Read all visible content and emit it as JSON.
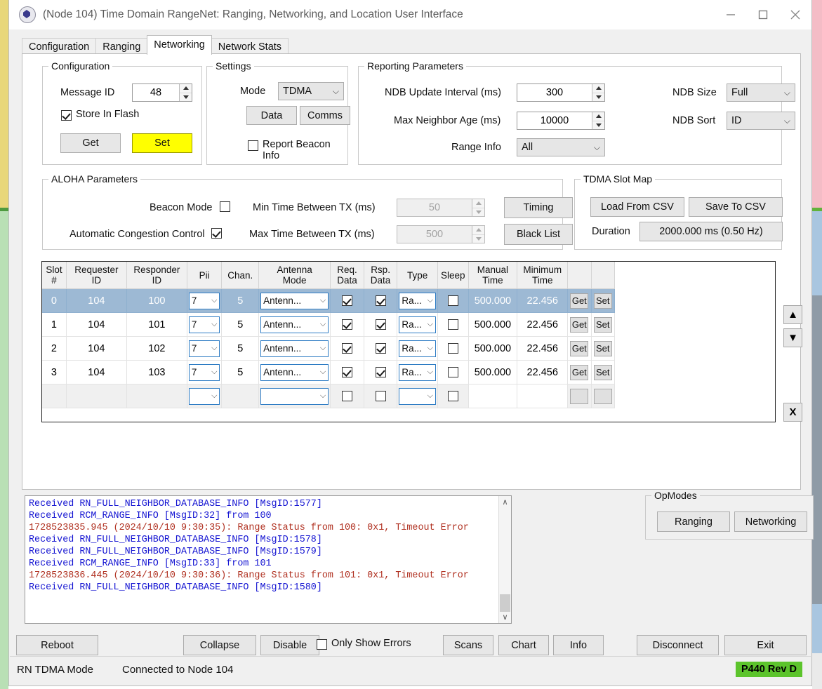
{
  "window": {
    "title": "(Node 104) Time Domain RangeNet: Ranging, Networking, and Location User Interface",
    "app_icon": "app-logo-icon",
    "minimize": "minimize-icon",
    "maximize": "maximize-icon",
    "close": "close-icon"
  },
  "tabs": [
    {
      "label": "Configuration",
      "active": false
    },
    {
      "label": "Ranging",
      "active": false
    },
    {
      "label": "Networking",
      "active": true
    },
    {
      "label": "Network Stats",
      "active": false
    }
  ],
  "configuration": {
    "legend": "Configuration",
    "message_id_label": "Message ID",
    "message_id_value": "48",
    "store_in_flash_label": "Store In Flash",
    "store_in_flash_checked": true,
    "get_label": "Get",
    "set_label": "Set",
    "set_highlight_color": "#ffff00"
  },
  "settings": {
    "legend": "Settings",
    "mode_label": "Mode",
    "mode_value": "TDMA",
    "data_label": "Data",
    "comms_label": "Comms",
    "report_beacon_label": "Report Beacon Info",
    "report_beacon_checked": false
  },
  "reporting": {
    "legend": "Reporting Parameters",
    "ndb_update_label": "NDB Update Interval (ms)",
    "ndb_update_value": "300",
    "max_neighbor_age_label": "Max Neighbor Age (ms)",
    "max_neighbor_age_value": "10000",
    "range_info_label": "Range Info",
    "range_info_value": "All",
    "ndb_size_label": "NDB Size",
    "ndb_size_value": "Full",
    "ndb_sort_label": "NDB Sort",
    "ndb_sort_value": "ID"
  },
  "aloha": {
    "legend": "ALOHA Parameters",
    "beacon_mode_label": "Beacon Mode",
    "beacon_mode_checked": false,
    "acc_label": "Automatic Congestion Control",
    "acc_checked": true,
    "min_tx_label": "Min Time Between TX (ms)",
    "min_tx_value": "50",
    "max_tx_label": "Max Time Between TX (ms)",
    "max_tx_value": "500",
    "timing_label": "Timing",
    "blacklist_label": "Black List"
  },
  "tdma_slot_map": {
    "legend": "TDMA Slot Map",
    "load_csv_label": "Load From CSV",
    "save_csv_label": "Save To CSV",
    "duration_label": "Duration",
    "duration_value": "2000.000 ms (0.50 Hz)"
  },
  "slot_table": {
    "headers": [
      "Slot\n#",
      "Requester\nID",
      "Responder\nID",
      "Pii",
      "Chan.",
      "Antenna\nMode",
      "Req.\nData",
      "Rsp.\nData",
      "Type",
      "Sleep",
      "Manual\nTime",
      "Minimum\nTime",
      "",
      ""
    ],
    "rows": [
      {
        "slot": "0",
        "requester": "104",
        "responder": "100",
        "pii": "7",
        "chan": "5",
        "antenna": "Antenn...",
        "req_data": true,
        "rsp_data": true,
        "type": "Ra...",
        "sleep": false,
        "manual": "500.000",
        "minimum": "22.456",
        "btn1": "Get",
        "btn2": "Set",
        "selected": true
      },
      {
        "slot": "1",
        "requester": "104",
        "responder": "101",
        "pii": "7",
        "chan": "5",
        "antenna": "Antenn...",
        "req_data": true,
        "rsp_data": true,
        "type": "Ra...",
        "sleep": false,
        "manual": "500.000",
        "minimum": "22.456",
        "btn1": "Get",
        "btn2": "Set",
        "selected": false
      },
      {
        "slot": "2",
        "requester": "104",
        "responder": "102",
        "pii": "7",
        "chan": "5",
        "antenna": "Antenn...",
        "req_data": true,
        "rsp_data": true,
        "type": "Ra...",
        "sleep": false,
        "manual": "500.000",
        "minimum": "22.456",
        "btn1": "Get",
        "btn2": "Set",
        "selected": false
      },
      {
        "slot": "3",
        "requester": "104",
        "responder": "103",
        "pii": "7",
        "chan": "5",
        "antenna": "Antenn...",
        "req_data": true,
        "rsp_data": true,
        "type": "Ra...",
        "sleep": false,
        "manual": "500.000",
        "minimum": "22.456",
        "btn1": "Get",
        "btn2": "Set",
        "selected": false
      },
      {
        "slot": "",
        "requester": "",
        "responder": "",
        "pii": "",
        "chan": "",
        "antenna": "",
        "req_data": false,
        "rsp_data": false,
        "type": "",
        "sleep": false,
        "manual": "",
        "minimum": "",
        "btn1": "",
        "btn2": "",
        "selected": false,
        "empty": true
      }
    ],
    "side_buttons": {
      "up": "▲",
      "down": "▼",
      "delete": "X"
    }
  },
  "log": {
    "lines": [
      {
        "text": "Received RN_FULL_NEIGHBOR_DATABASE_INFO [MsgID:1577]",
        "color": "blue"
      },
      {
        "text": "Received RCM_RANGE_INFO [MsgID:32] from 100",
        "color": "blue"
      },
      {
        "text": "1728523835.945 (2024/10/10 9:30:35): Range Status from 100: 0x1, Timeout Error",
        "color": "red"
      },
      {
        "text": "Received RN_FULL_NEIGHBOR_DATABASE_INFO [MsgID:1578]",
        "color": "blue"
      },
      {
        "text": "Received RN_FULL_NEIGHBOR_DATABASE_INFO [MsgID:1579]",
        "color": "blue"
      },
      {
        "text": "Received RCM_RANGE_INFO [MsgID:33] from 101",
        "color": "blue"
      },
      {
        "text": "1728523836.445 (2024/10/10 9:30:36): Range Status from 101: 0x1, Timeout Error",
        "color": "red"
      },
      {
        "text": "Received RN_FULL_NEIGHBOR_DATABASE_INFO [MsgID:1580]",
        "color": "blue"
      }
    ],
    "scroll_up": "∧",
    "scroll_down": "∨"
  },
  "opmodes": {
    "legend": "OpModes",
    "ranging_label": "Ranging",
    "networking_label": "Networking"
  },
  "bottom_bar": {
    "reboot_label": "Reboot",
    "collapse_label": "Collapse",
    "disable_label": "Disable",
    "only_show_errors_label": "Only Show Errors",
    "only_show_errors_checked": false,
    "scans_label": "Scans",
    "chart_label": "Chart",
    "info_label": "Info",
    "disconnect_label": "Disconnect",
    "exit_label": "Exit"
  },
  "status_bar": {
    "mode": "RN TDMA Mode",
    "connection": "Connected to Node 104",
    "rev_badge": "P440 Rev D",
    "rev_badge_color": "#5cc42c"
  }
}
